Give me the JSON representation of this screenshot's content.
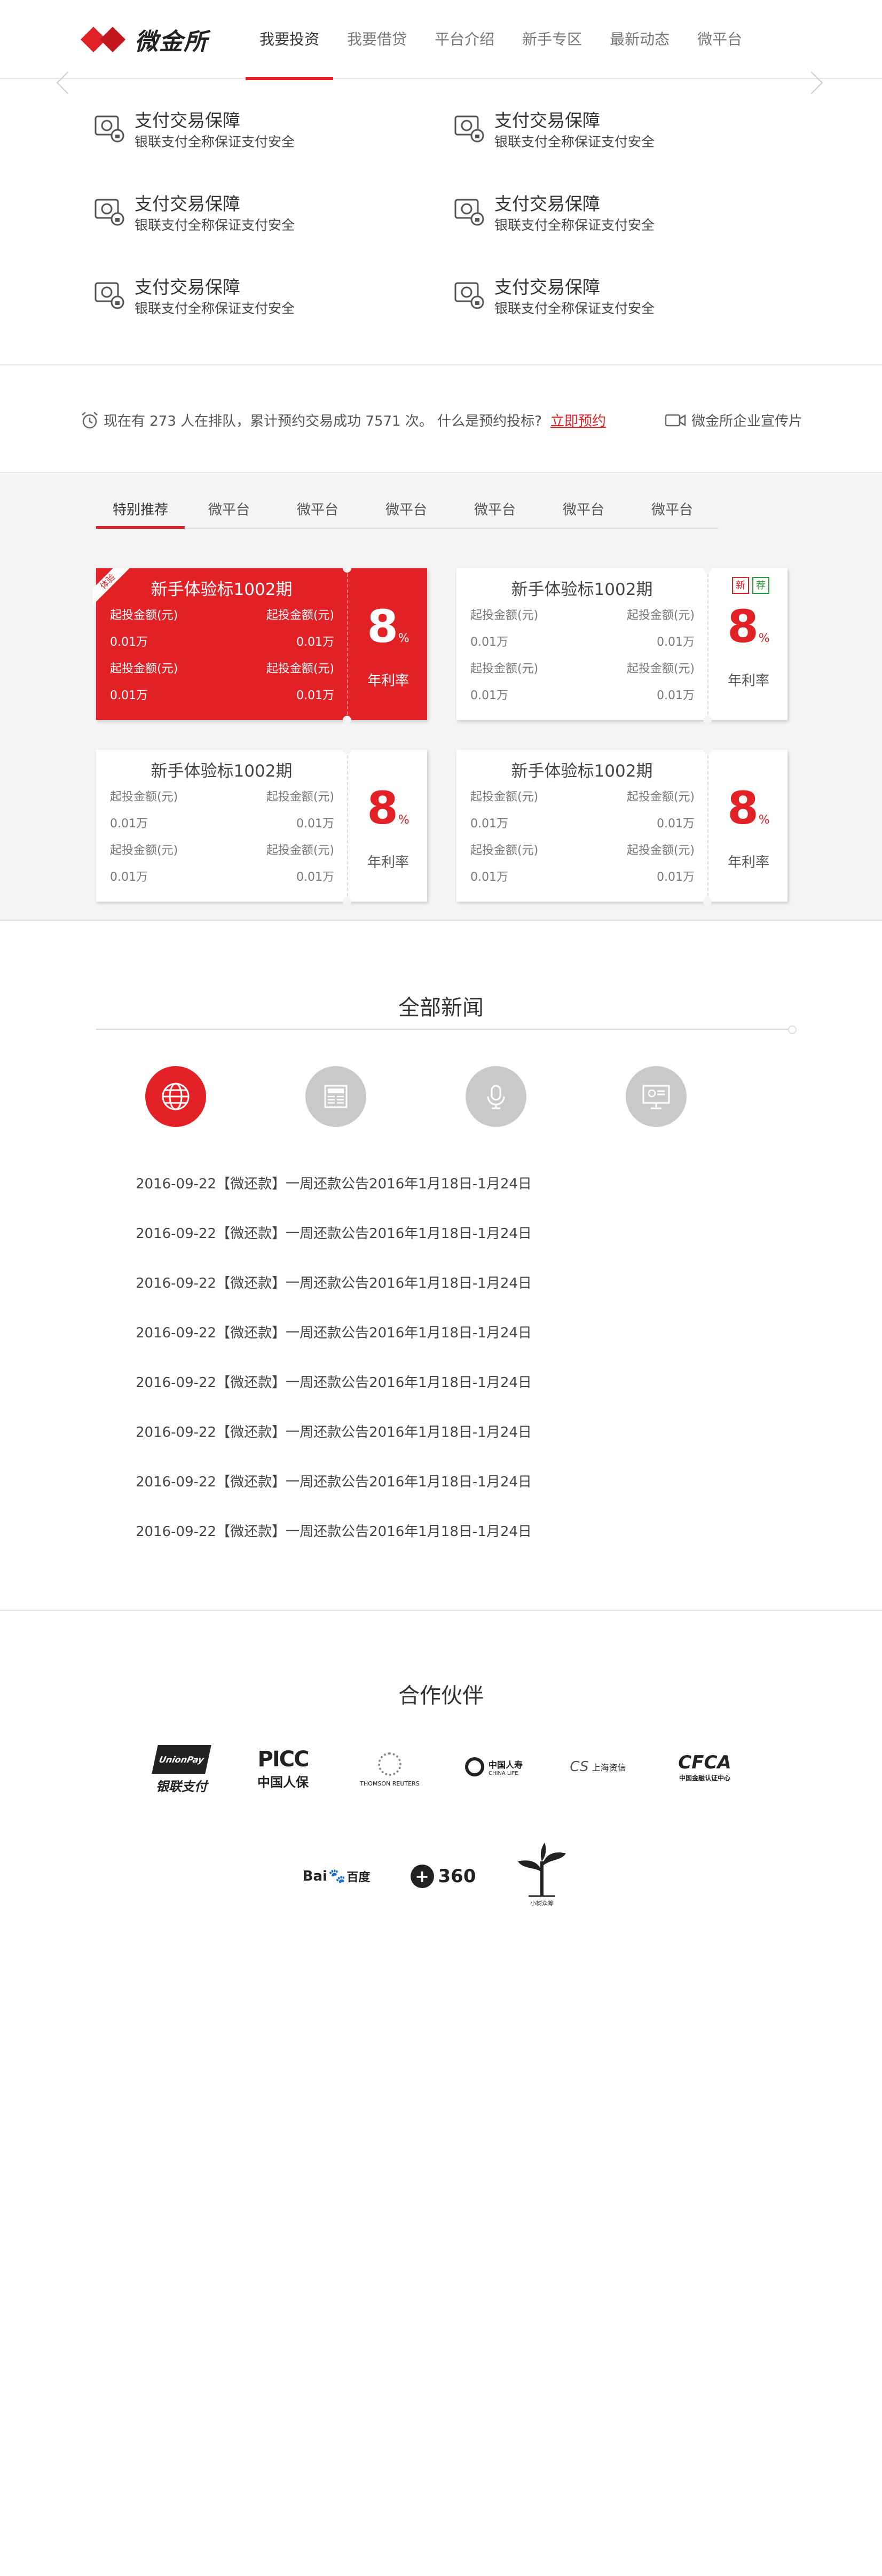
{
  "header": {
    "logo_text": "微金所",
    "nav": [
      "我要投资",
      "我要借贷",
      "平台介绍",
      "新手专区",
      "最新动态",
      "微平台"
    ]
  },
  "guarantees": [
    {
      "title": "支付交易保障",
      "sub": "银联支付全称保证支付安全"
    },
    {
      "title": "支付交易保障",
      "sub": "银联支付全称保证支付安全"
    },
    {
      "title": "支付交易保障",
      "sub": "银联支付全称保证支付安全"
    },
    {
      "title": "支付交易保障",
      "sub": "银联支付全称保证支付安全"
    },
    {
      "title": "支付交易保障",
      "sub": "银联支付全称保证支付安全"
    },
    {
      "title": "支付交易保障",
      "sub": "银联支付全称保证支付安全"
    }
  ],
  "notice": {
    "text_before": "现在有 273 人在排队，累计预约交易成功 7571 次。 什么是预约投标?",
    "link": "立即预约",
    "video": "微金所企业宣传片"
  },
  "products": {
    "tabs": [
      "特别推荐",
      "微平台",
      "微平台",
      "微平台",
      "微平台",
      "微平台",
      "微平台"
    ],
    "cards": [
      {
        "title": "新手体验标1002期",
        "rows": [
          [
            "起投金额(元)",
            "起投金额(元)"
          ],
          [
            "0.01万",
            "0.01万"
          ],
          [
            "起投金额(元)",
            "起投金额(元)"
          ],
          [
            "0.01万",
            "0.01万"
          ]
        ],
        "rate": "8",
        "pct": "%",
        "rate_label": "年利率",
        "ribbon": "体验"
      },
      {
        "title": "新手体验标1002期",
        "rows": [
          [
            "起投金额(元)",
            "起投金额(元)"
          ],
          [
            "0.01万",
            "0.01万"
          ],
          [
            "起投金额(元)",
            "起投金额(元)"
          ],
          [
            "0.01万",
            "0.01万"
          ]
        ],
        "rate": "8",
        "pct": "%",
        "rate_label": "年利率",
        "badges": [
          "新",
          "荐"
        ]
      },
      {
        "title": "新手体验标1002期",
        "rows": [
          [
            "起投金额(元)",
            "起投金额(元)"
          ],
          [
            "0.01万",
            "0.01万"
          ],
          [
            "起投金额(元)",
            "起投金额(元)"
          ],
          [
            "0.01万",
            "0.01万"
          ]
        ],
        "rate": "8",
        "pct": "%",
        "rate_label": "年利率"
      },
      {
        "title": "新手体验标1002期",
        "rows": [
          [
            "起投金额(元)",
            "起投金额(元)"
          ],
          [
            "0.01万",
            "0.01万"
          ],
          [
            "起投金额(元)",
            "起投金额(元)"
          ],
          [
            "0.01万",
            "0.01万"
          ]
        ],
        "rate": "8",
        "pct": "%",
        "rate_label": "年利率"
      }
    ]
  },
  "news": {
    "title": "全部新闻",
    "items": [
      "2016-09-22【微还款】一周还款公告2016年1月18日-1月24日",
      "2016-09-22【微还款】一周还款公告2016年1月18日-1月24日",
      "2016-09-22【微还款】一周还款公告2016年1月18日-1月24日",
      "2016-09-22【微还款】一周还款公告2016年1月18日-1月24日",
      "2016-09-22【微还款】一周还款公告2016年1月18日-1月24日",
      "2016-09-22【微还款】一周还款公告2016年1月18日-1月24日",
      "2016-09-22【微还款】一周还款公告2016年1月18日-1月24日",
      "2016-09-22【微还款】一周还款公告2016年1月18日-1月24日"
    ]
  },
  "partners": {
    "title": "合作伙伴",
    "logos": [
      "银联支付",
      "PICC",
      "中国人保",
      "THOMSON REUTERS",
      "中国人寿",
      "CHINA LIFE",
      "上海资信",
      "CFCA",
      "中国金融认证中心",
      "Bai",
      "百度",
      "360",
      "小树众筹"
    ]
  },
  "colors": {
    "accent": "#e22126",
    "icon_gray": "#c9c9c9"
  }
}
